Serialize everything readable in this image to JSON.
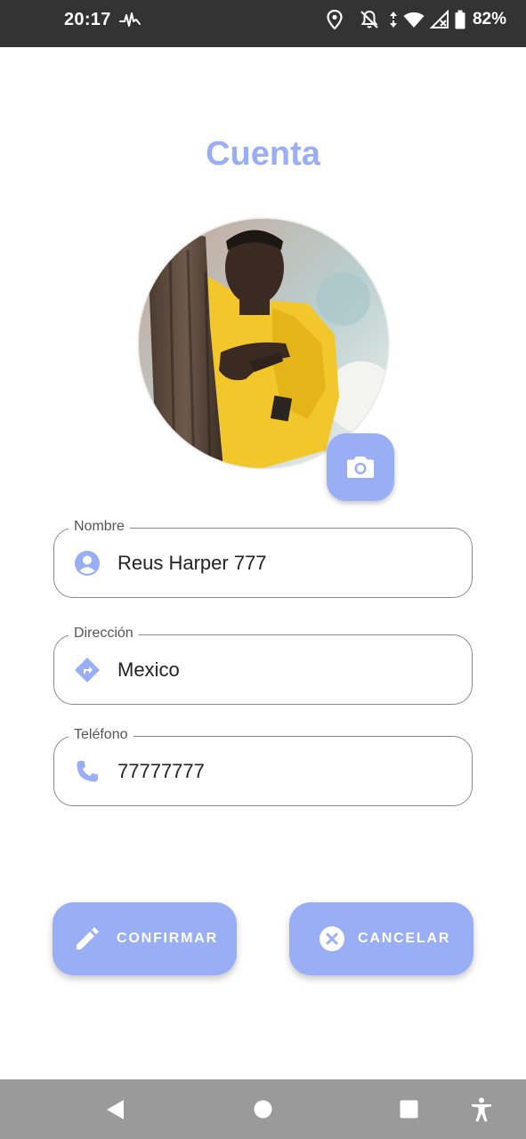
{
  "status_bar": {
    "time": "20:17",
    "battery_percent": "82%",
    "icons": [
      "activity-icon",
      "location-icon",
      "notifications-off-icon",
      "data-arrows-icon",
      "wifi-icon",
      "no-signal-icon",
      "battery-icon"
    ]
  },
  "page": {
    "title": "Cuenta"
  },
  "avatar": {
    "icon": "camera-icon"
  },
  "form": {
    "nombre": {
      "label": "Nombre",
      "value": "Reus Harper 777",
      "icon": "person-icon"
    },
    "direccion": {
      "label": "Dirección",
      "value": "Mexico",
      "icon": "directions-icon"
    },
    "telefono": {
      "label": "Teléfono",
      "value": "77777777",
      "icon": "phone-icon"
    }
  },
  "actions": {
    "confirm_label": "CONFIRMAR",
    "cancel_label": "CANCELAR"
  },
  "nav_bar": {
    "items": [
      "back-icon",
      "home-icon",
      "recents-icon",
      "accessibility-icon"
    ]
  },
  "colors": {
    "accent": "#9aaef6",
    "status_bar": "#333333",
    "nav_bar": "#9a9a9a",
    "field_border": "#8a8a8a"
  }
}
